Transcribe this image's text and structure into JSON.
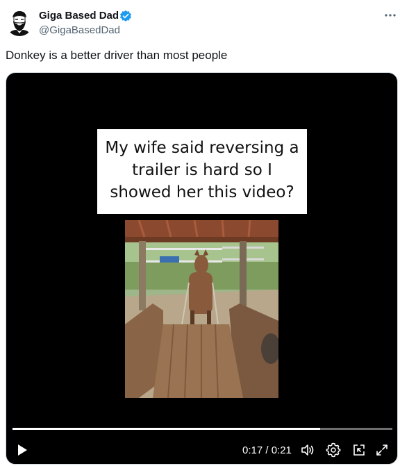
{
  "author": {
    "name": "Giga Based Dad",
    "handle": "@GigaBasedDad",
    "verified": true
  },
  "tweet": {
    "text": "Donkey is a better driver than most people"
  },
  "video": {
    "caption_lines": [
      "My wife said reversing a",
      "trailer is hard so I",
      "showed her this video?"
    ],
    "time_display": "0:17 / 0:21",
    "progress_fraction": 0.81
  },
  "icons": {
    "more": "more-horizontal-icon",
    "verified": "verified-badge-icon",
    "play": "play-icon",
    "volume": "volume-icon",
    "settings": "settings-gear-icon",
    "pip": "picture-in-picture-icon",
    "fullscreen": "fullscreen-icon"
  },
  "colors": {
    "verified_blue": "#1d9bf0",
    "text_primary": "#0f1419",
    "text_secondary": "#536471",
    "video_bg": "#000000"
  }
}
